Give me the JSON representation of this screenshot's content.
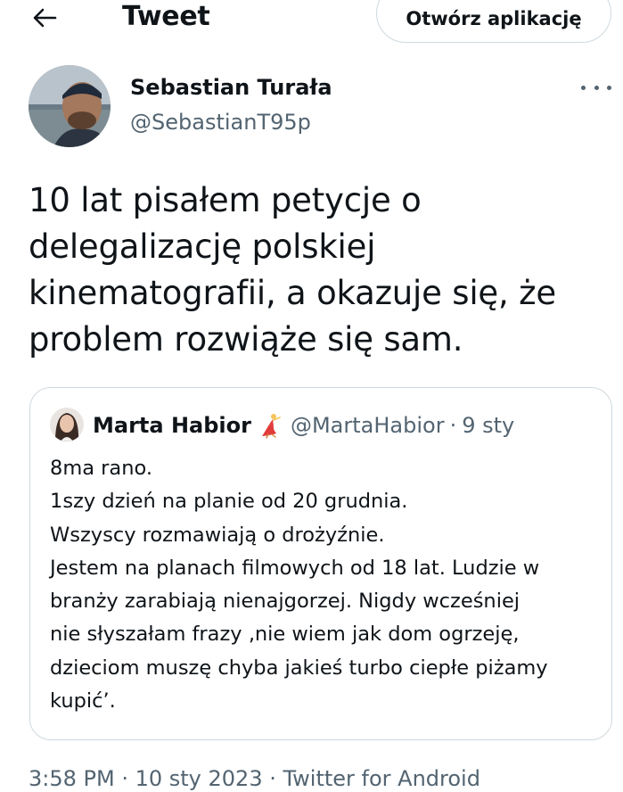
{
  "header": {
    "title": "Tweet",
    "open_app_label": "Otwórz aplikację"
  },
  "author": {
    "name": "Sebastian Turała",
    "handle": "@SebastianT95p"
  },
  "tweet": {
    "lines": [
      "10 lat pisałem petycje o",
      "delegalizację polskiej",
      "kinematografii, a okazuje się, że",
      "problem rozwiąże się sam."
    ]
  },
  "quoted": {
    "name": "Marta Habior",
    "emoji_icon": "dancer-emoji",
    "handle": "@MartaHabior",
    "separator": "·",
    "date": "9 sty",
    "lines": [
      "8ma rano.",
      "1szy dzień na planie od 20 grudnia.",
      "Wszyscy rozmawiają o drożyźnie.",
      "Jestem na planach filmowych od 18 lat. Ludzie w",
      "branży zarabiają nienajgorzej. Nigdy wcześniej",
      "nie słyszałam frazy ‚nie wiem jak dom ogrzeję,",
      "dzieciom muszę chyba jakieś turbo ciepłe piżamy",
      "kupić’."
    ]
  },
  "meta": {
    "text": "3:58 PM · 10 sty 2023 · Twitter for Android"
  },
  "colors": {
    "text": "#0f1419",
    "secondary": "#536471",
    "border": "#cfd9de"
  }
}
